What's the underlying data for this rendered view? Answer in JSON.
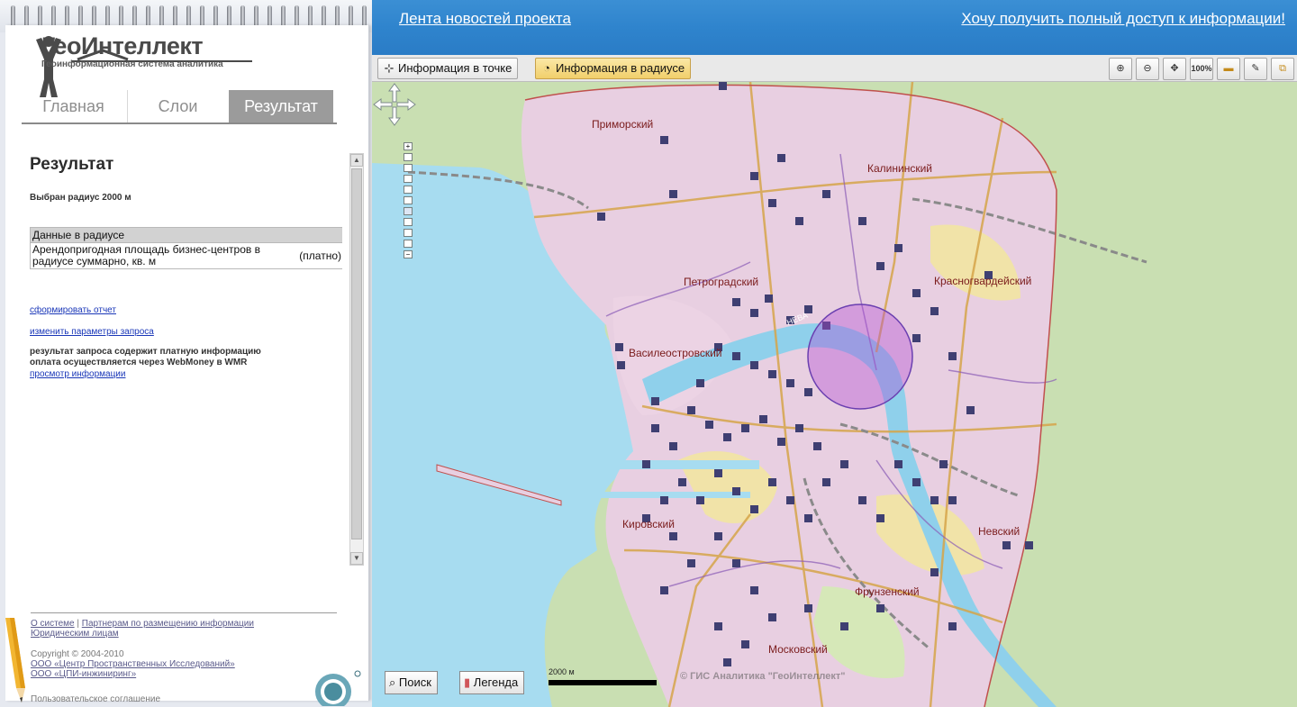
{
  "brand": {
    "name": "ГеоИнтеллект",
    "subtitle": "Геоинформационная система аналитика"
  },
  "tabs": [
    {
      "label": "Главная",
      "active": false
    },
    {
      "label": "Слои",
      "active": false
    },
    {
      "label": "Результат",
      "active": true
    }
  ],
  "result": {
    "heading": "Результат",
    "radius_text": "Выбран радиус 2000 м",
    "table": {
      "header": "Данные в радиусе",
      "rows": [
        {
          "name": "Арендопригодная площадь бизнес-центров в радиусе суммарно, кв. м",
          "value": "(платно)"
        }
      ]
    },
    "report_link": "сформировать отчет",
    "params_link": "изменить параметры запроса",
    "notice_line1": "результат запроса содержит платную информацию",
    "notice_line2": "оплата осуществляется через WebMoney в WMR",
    "view_link": "просмотр информации"
  },
  "footer": {
    "about": "О системе",
    "partners": "Партнерам по размещению информации",
    "legal": "Юридическим лицам",
    "copyright": "Copyright © 2004-2010",
    "org1": "ООО «Центр Пространственных Исследований»",
    "org2": "ООО «ЦПИ-инжиниринг»",
    "agreement": "Пользовательское соглашение"
  },
  "topbar": {
    "news_link": "Лента новостей проекта",
    "access_link": "Хочу получить полный доступ к информации!"
  },
  "toolbar": {
    "info_point": "Информация в точке",
    "info_radius": "Информация в радиусе",
    "zoom100": "100%"
  },
  "map": {
    "districts": [
      "Приморский",
      "Калининский",
      "Петроградский",
      "Красногвардейский",
      "Василеостровский",
      "Кировский",
      "Невский",
      "Фрунзенский",
      "Московский"
    ],
    "river_label": "НЕВА",
    "search_button": "Поиск",
    "legend_button": "Легенда",
    "scale_label": "2000 м",
    "copyright": "© ГИС Аналитика \"ГеоИнтеллект\"",
    "colors": {
      "water": "#a7dcf0",
      "land": "#c9dfb2",
      "urban": "#e8cfe1",
      "roads": "#d6a54a",
      "selection": "#b04ad6"
    }
  }
}
